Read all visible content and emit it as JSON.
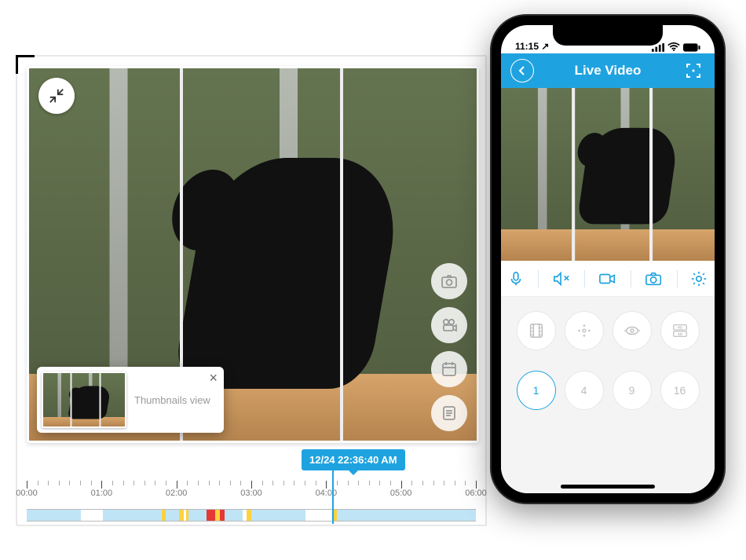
{
  "accent": "#1fa3e0",
  "playback": {
    "timestamp": "12/24 22:36:40 AM",
    "thumbnail_label": "Thumbnails view",
    "thumbnail_close": "×",
    "side_buttons": [
      "snapshot",
      "record-video",
      "calendar",
      "document"
    ],
    "playhead_pct": 68,
    "timeline": {
      "ticks": [
        "00:00",
        "01:00",
        "02:00",
        "03:00",
        "04:00",
        "05:00",
        "06:00"
      ],
      "segments": [
        {
          "kind": "idle",
          "start": 0,
          "end": 12
        },
        {
          "kind": "idle",
          "start": 17,
          "end": 30
        },
        {
          "kind": "warn",
          "start": 30,
          "end": 31
        },
        {
          "kind": "idle",
          "start": 31,
          "end": 34
        },
        {
          "kind": "warn",
          "start": 34,
          "end": 35
        },
        {
          "kind": "warn",
          "start": 35.5,
          "end": 36
        },
        {
          "kind": "idle",
          "start": 36,
          "end": 40
        },
        {
          "kind": "alert",
          "start": 40,
          "end": 42
        },
        {
          "kind": "warn",
          "start": 42,
          "end": 43
        },
        {
          "kind": "alert",
          "start": 43,
          "end": 44
        },
        {
          "kind": "idle",
          "start": 44,
          "end": 48
        },
        {
          "kind": "warn",
          "start": 49,
          "end": 50
        },
        {
          "kind": "idle",
          "start": 50,
          "end": 62
        },
        {
          "kind": "warn",
          "start": 68,
          "end": 69
        },
        {
          "kind": "idle",
          "start": 69,
          "end": 100
        }
      ]
    }
  },
  "phone": {
    "status": {
      "time": "11:15",
      "carrier_arrow": "↗",
      "indicators": [
        "signal",
        "wifi",
        "battery"
      ]
    },
    "header": {
      "title": "Live Video"
    },
    "toolbar": [
      "microphone",
      "speaker-muted",
      "video-camera",
      "photo-camera",
      "settings-gear"
    ],
    "controls1": [
      "film-roll",
      "directional-pad",
      "pan-tilt",
      "hd-sd-quality"
    ],
    "grid_labels": [
      "1",
      "4",
      "9",
      "16"
    ],
    "grid_active": "1"
  }
}
